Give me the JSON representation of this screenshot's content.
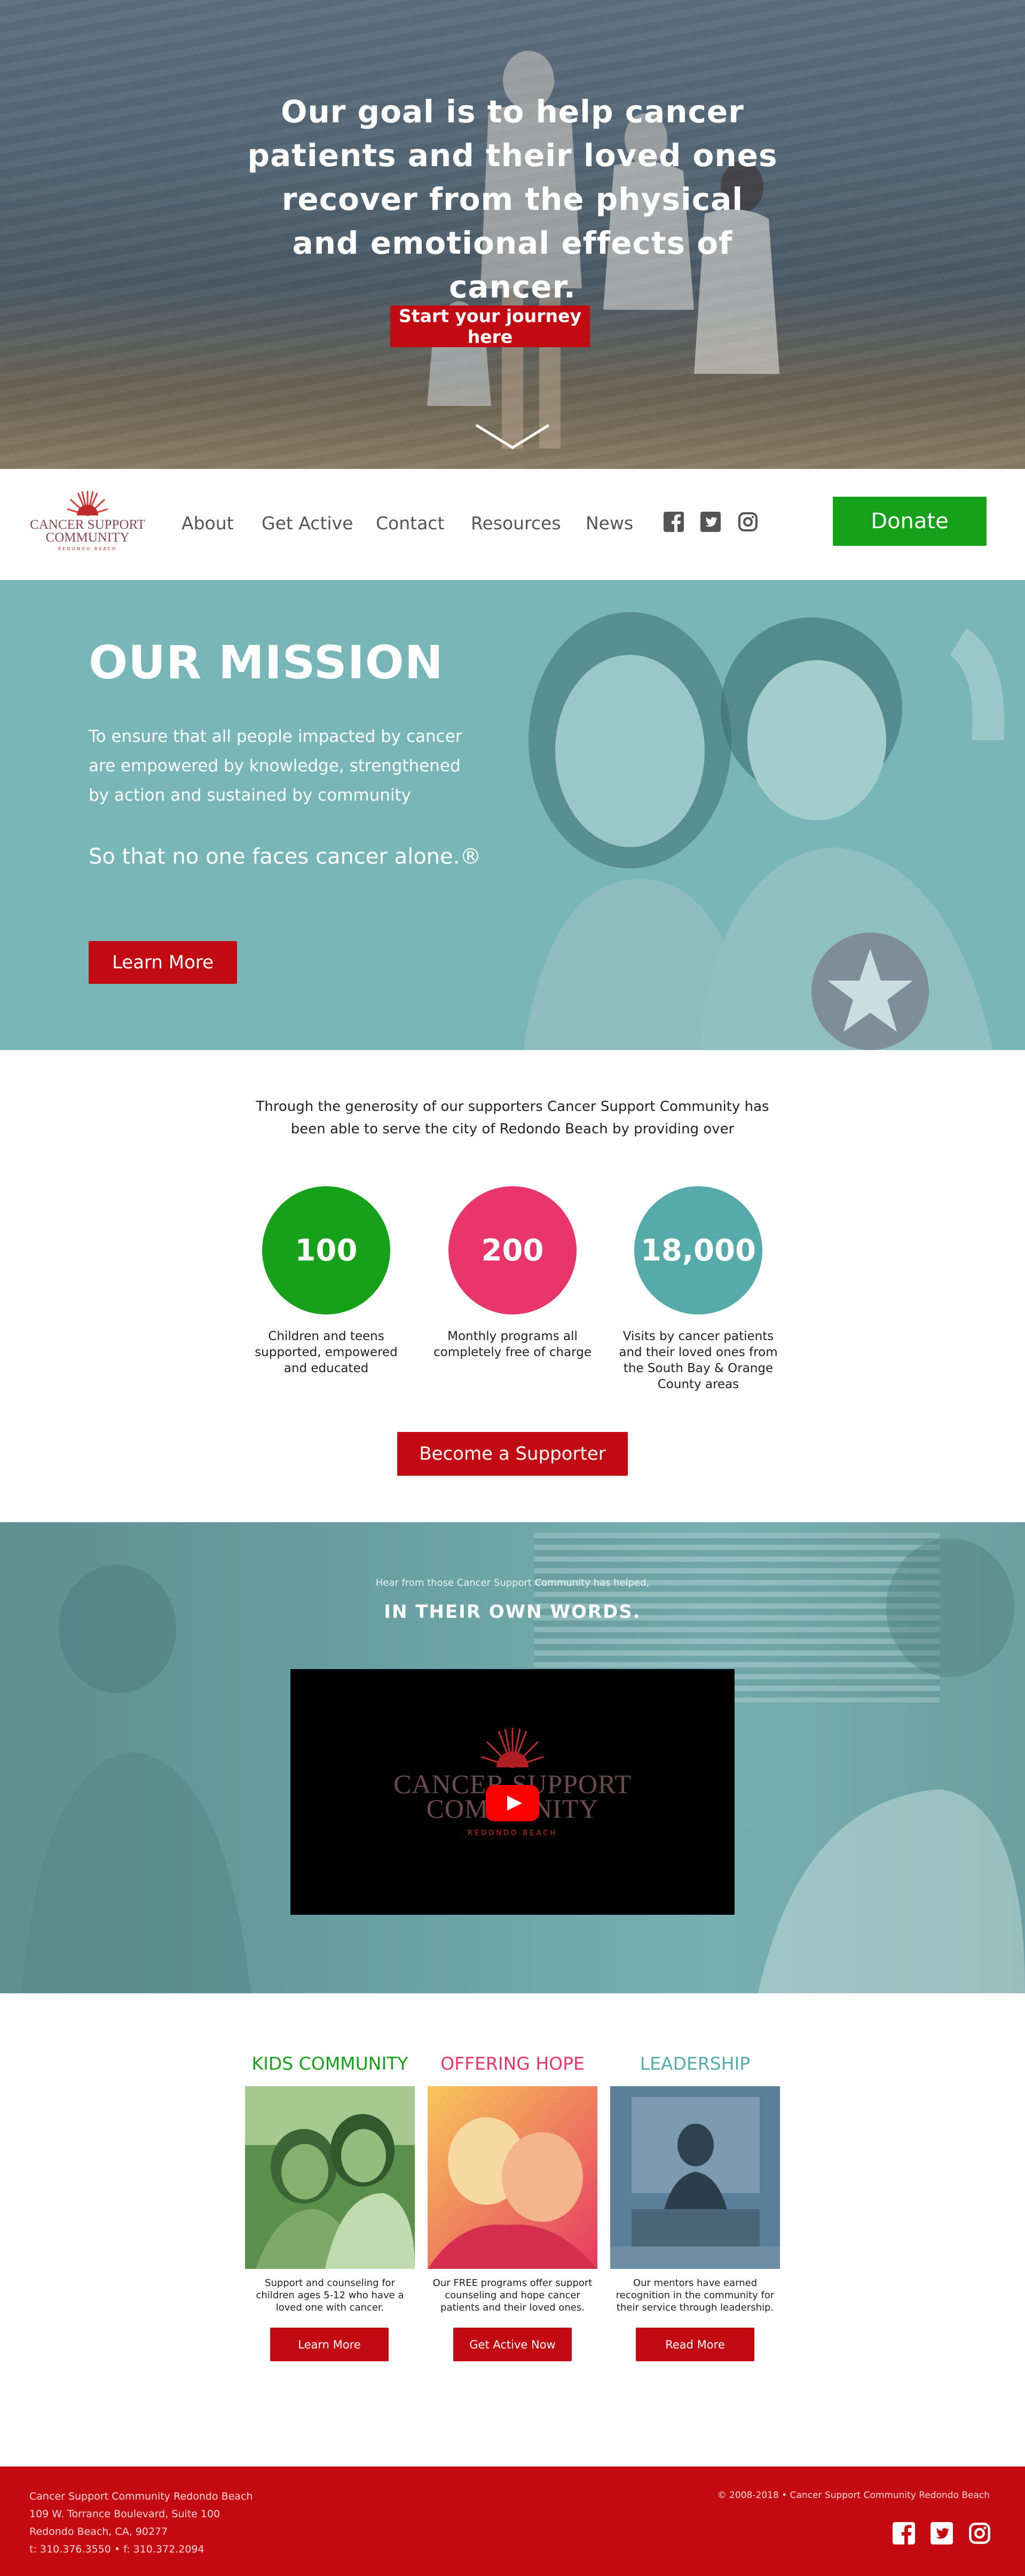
{
  "hero": {
    "title": "Our goal is to help cancer patients and their loved ones recover from the physical and emotional effects of cancer.",
    "cta": "Start your journey here"
  },
  "logo": {
    "line1": "CANCER SUPPORT",
    "line2": "COMMUNITY",
    "line3": "REDONDO BEACH"
  },
  "nav": {
    "links": [
      "About",
      "Get Active",
      "Contact",
      "Resources",
      "News"
    ],
    "social": [
      "facebook-icon",
      "twitter-icon",
      "instagram-icon"
    ],
    "donate": "Donate"
  },
  "mission": {
    "title": "OUR MISSION",
    "body": "To ensure that all people impacted by cancer are empowered by knowledge, strengthened by action and sustained by community",
    "tagline": "So that no one faces cancer alone.®",
    "button": "Learn More"
  },
  "stats": {
    "intro": "Through the generosity of our supporters Cancer Support Community has been able to serve the city of Redondo Beach by providing over",
    "items": [
      {
        "value": "100",
        "caption": "Children and teens supported, empowered and educated",
        "color": "#17a019"
      },
      {
        "value": "200",
        "caption": "Monthly programs all completely free of charge",
        "color": "#e8356a"
      },
      {
        "value": "18,000",
        "caption": "Visits by cancer patients and their loved ones from the South Bay & Orange County areas",
        "color": "#56aba9"
      }
    ],
    "button": "Become a Supporter"
  },
  "video": {
    "lead": "Hear from those Cancer Support Community has helped,",
    "title": "IN THEIR OWN WORDS.",
    "player_line1": "CANCER SUPPORT",
    "player_line2": "COMMUNITY",
    "player_line3": "REDONDO BEACH"
  },
  "cards": [
    {
      "title": "KIDS COMMUNITY",
      "color": "#17a019",
      "text": "Support and counseling for children ages 5-12 who have a loved one with cancer.",
      "button": "Learn More"
    },
    {
      "title": "OFFERING HOPE",
      "color": "#e8356a",
      "text": "Our FREE programs offer support counseling and hope cancer patients and their loved ones.",
      "button": "Get Active Now"
    },
    {
      "title": "LEADERSHIP",
      "color": "#56aba9",
      "text": "Our mentors have earned recognition in the community for their service through leadership.",
      "button": "Read More"
    }
  ],
  "footer": {
    "org": "Cancer Support Community Redondo Beach",
    "address1": "109 W. Torrance Boulevard, Suite 100",
    "address2": "Redondo Beach, CA, 90277",
    "phone": "t: 310.376.3550 • f: 310.372.2094",
    "copyright": "© 2008-2018 • Cancer Support Community Redondo Beach"
  }
}
